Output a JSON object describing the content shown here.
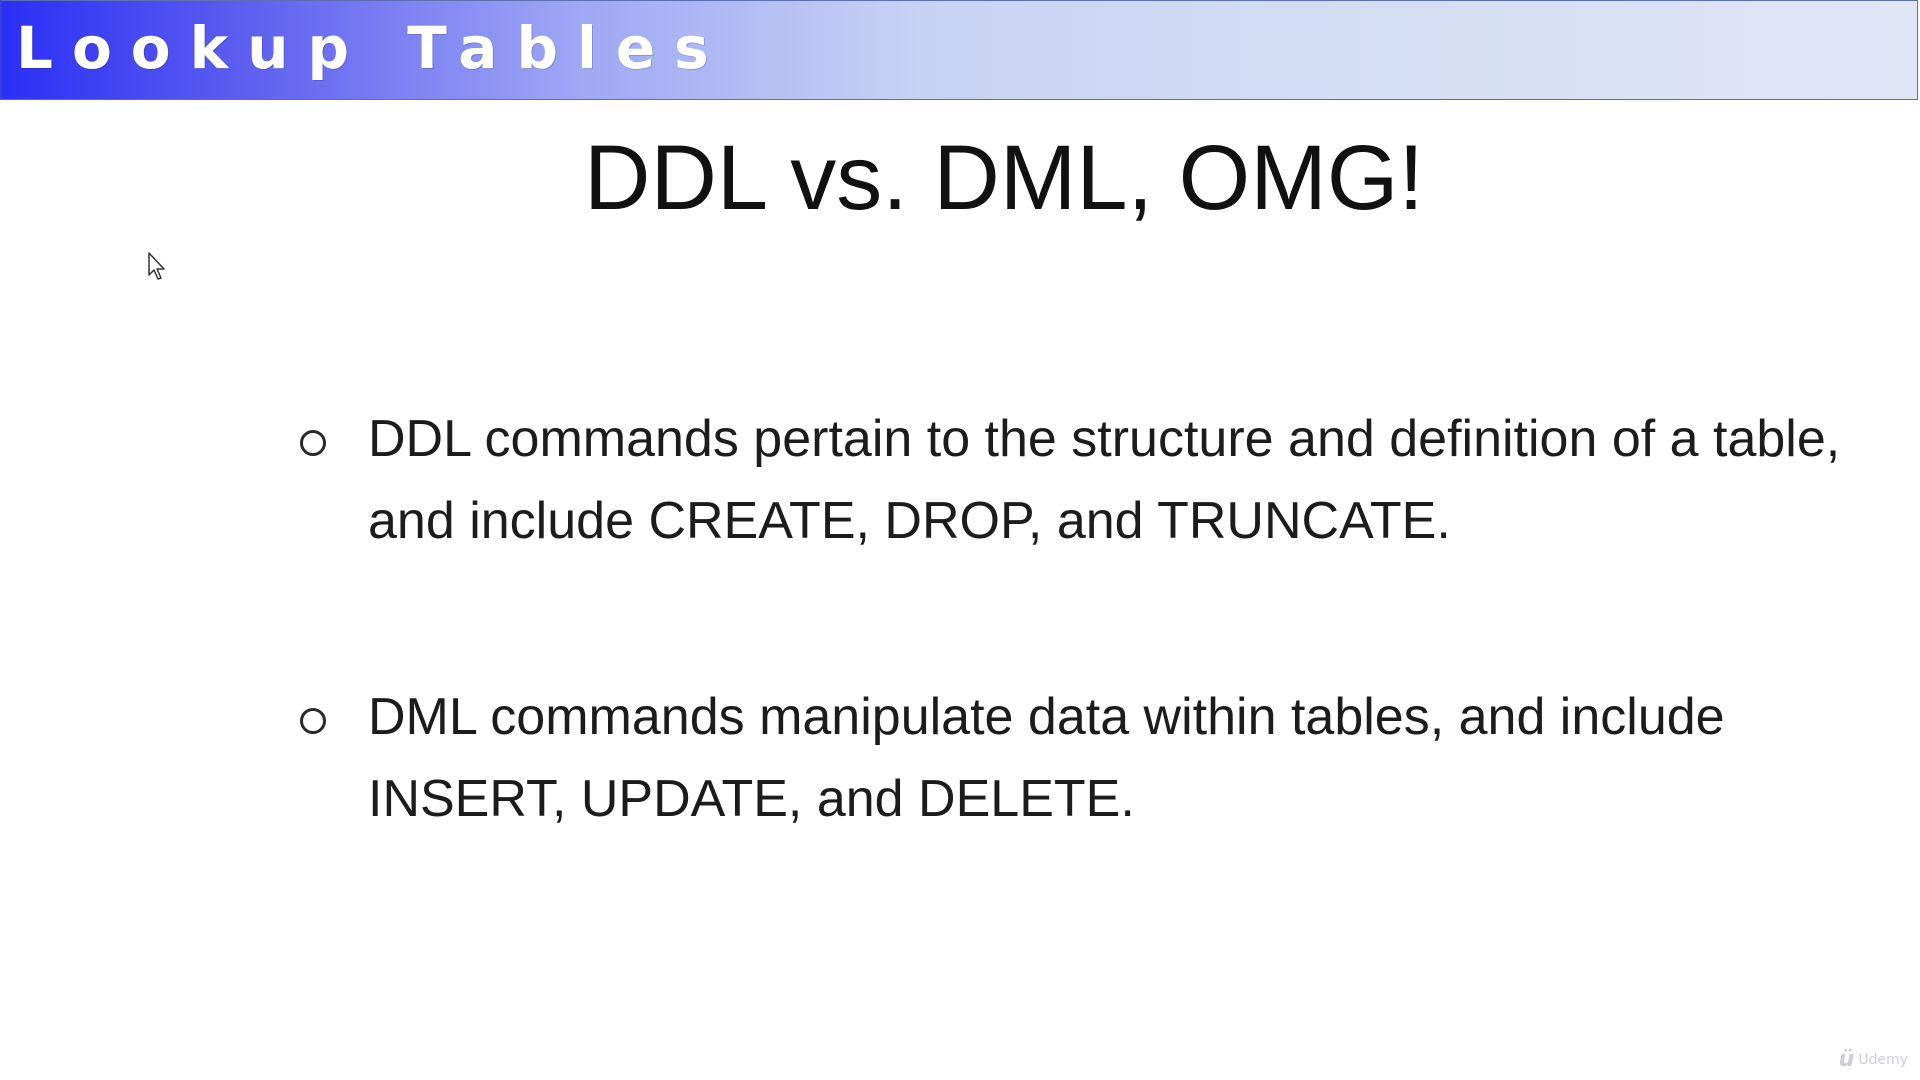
{
  "header": {
    "section_title": "Lookup Tables"
  },
  "slide": {
    "title": "DDL vs. DML, OMG!",
    "bullets": [
      {
        "marker": "circle-bullet-icon",
        "text": "DDL commands pertain to the structure and definition of a table, and include CREATE, DROP, and TRUNCATE."
      },
      {
        "marker": "circle-bullet-icon",
        "text": "DML commands manipulate data within tables, and include INSERT, UPDATE, and DELETE."
      }
    ]
  },
  "watermark": {
    "icon": "udemy-logo-icon",
    "text": "Udemy"
  },
  "cursor": {
    "icon": "mouse-pointer-icon"
  },
  "colors": {
    "header_start": "#2b2ff5",
    "header_end": "#e0e6f6",
    "title_text": "#111111",
    "body_text": "#1c1c1c"
  }
}
